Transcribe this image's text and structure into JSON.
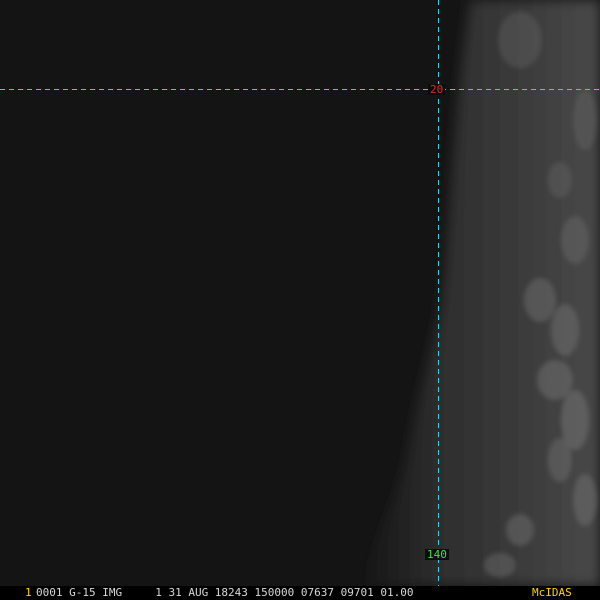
{
  "overlay": {
    "latitude_label": "20",
    "longitude_label": "140",
    "grid_color": "#2fd3e6",
    "latitude_label_color": "#e02a2a",
    "longitude_label_color": "#3ce63c"
  },
  "status_bar": {
    "frame_number": "1",
    "frame_number_color": "#ffd400",
    "header_text": "0001 G-15 IMG     1 31 AUG 18243 150000 07637 09701 01.00",
    "header_color": "#d8d8d8",
    "logo_text": "McIDAS",
    "logo_color": "#ffd400"
  }
}
